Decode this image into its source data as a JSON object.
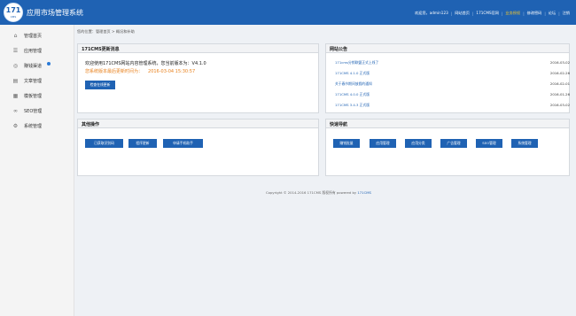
{
  "header": {
    "logo_text": "171",
    "logo_sub": "CMS",
    "title": "应用市场管理系统",
    "nav": [
      {
        "label": "欢迎您，admin123",
        "highlight": false
      },
      {
        "label": "网站首页",
        "highlight": false
      },
      {
        "label": "171CMS官网",
        "highlight": false
      },
      {
        "label": "业务授权",
        "highlight": true
      },
      {
        "label": "修改密码",
        "highlight": false
      },
      {
        "label": "论坛",
        "highlight": false
      },
      {
        "label": "注销",
        "highlight": false
      }
    ]
  },
  "sidebar": {
    "items": [
      {
        "label": "管理首页",
        "icon": "home-icon"
      },
      {
        "label": "应用管理",
        "icon": "list-icon"
      },
      {
        "label": "赚钱渠道",
        "icon": "circle-icon",
        "badge": true
      },
      {
        "label": "文章管理",
        "icon": "document-icon"
      },
      {
        "label": "模板管理",
        "icon": "template-icon"
      },
      {
        "label": "SEO管理",
        "icon": "seo-icon"
      },
      {
        "label": "系统管理",
        "icon": "gear-icon"
      }
    ]
  },
  "breadcrumb": "您的位置：管理首页 > 概况和补助",
  "update_panel": {
    "title": "171CMS更新消息",
    "welcome": "欢迎使用171CMS网站内容管理系统，您当前版本为：V4.1.0",
    "notice": "您系统版本最后更新时间为：",
    "notice_time": "2016-03-04 15:30:57",
    "check_button": "检查在线更新"
  },
  "announce_panel": {
    "title": "网站公告",
    "items": [
      {
        "title": "171cms分销联盟正式上线了",
        "date": "2016-03-02"
      },
      {
        "title": "171CMS 4.1.0 正式版",
        "date": "2016-02-26"
      },
      {
        "title": "关于春节期间放假的通知",
        "date": "2016-02-01"
      },
      {
        "title": "171CMS 4.0.0 正式版",
        "date": "2016-01-26"
      },
      {
        "title": "171CMS 3.4.3 正式版",
        "date": "2016-03-02"
      }
    ]
  },
  "quick_panel": {
    "title": "其他操作",
    "buttons": [
      "已获取识别码",
      "程序更新",
      "申请手机助手"
    ]
  },
  "nav_panel": {
    "title": "快速导航",
    "buttons": [
      "赚钱批量",
      "应用管理",
      "应用分类",
      "广告管理",
      "SEO管理",
      "系统管理"
    ]
  },
  "footer": {
    "text": "Copyright © 2014-2016 171CMS 版权所有 powered by",
    "brand": "171CMS"
  }
}
